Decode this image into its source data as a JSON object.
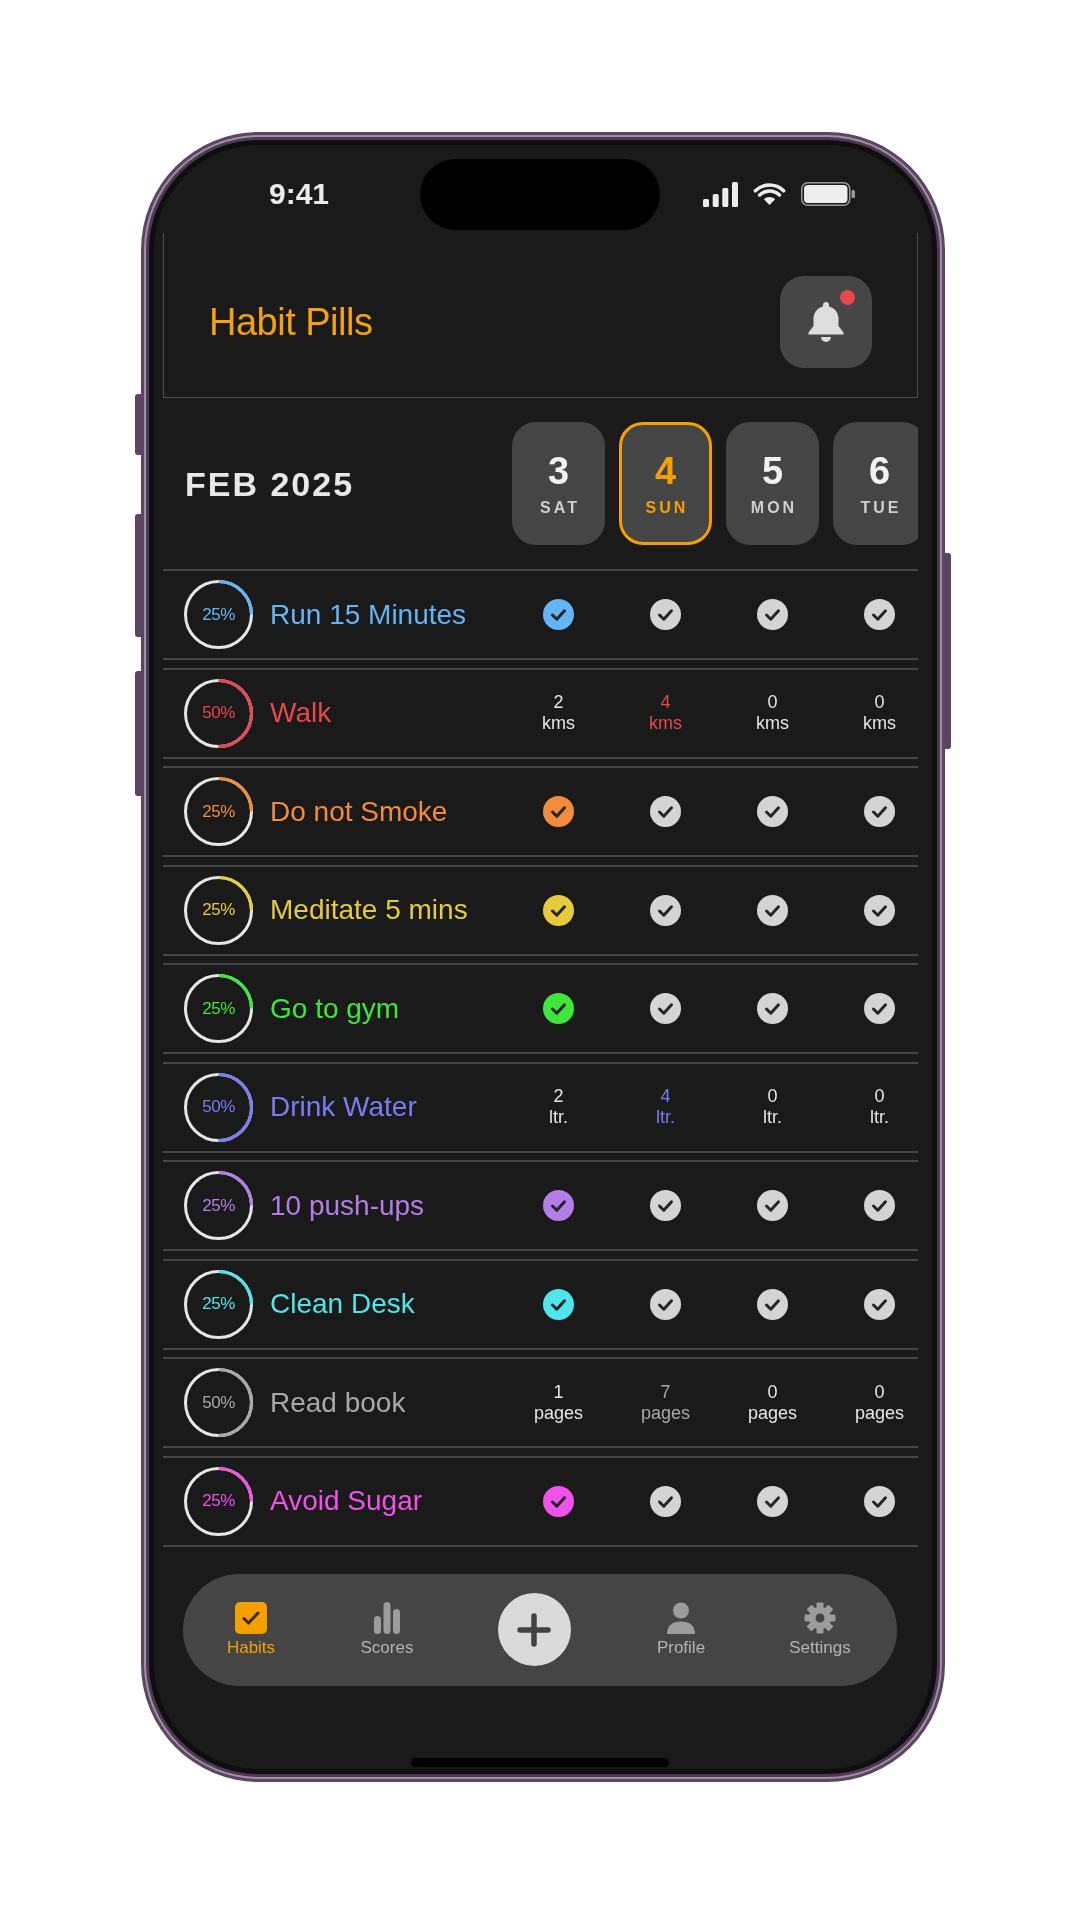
{
  "status_bar": {
    "time": "9:41"
  },
  "header": {
    "title": "Habit Pills",
    "notification_dot": true
  },
  "month": "FEB 2025",
  "dates": [
    {
      "day": "3",
      "weekday": "SAT",
      "selected": false
    },
    {
      "day": "4",
      "weekday": "SUN",
      "selected": true
    },
    {
      "day": "5",
      "weekday": "MON",
      "selected": false
    },
    {
      "day": "6",
      "weekday": "TUE",
      "selected": false
    }
  ],
  "habits": [
    {
      "name": "Run 15 Minutes",
      "color": "#64b5f6",
      "progress": {
        "label": "25%",
        "level": 0.25
      },
      "kind": "check",
      "days": [
        {
          "done": true
        },
        {
          "done": false
        },
        {
          "done": false
        },
        {
          "done": false
        }
      ]
    },
    {
      "name": "Walk",
      "color": "#e5484d",
      "progress": {
        "label": "50%",
        "level": 0.5
      },
      "kind": "amount",
      "days": [
        {
          "amount": "2 kms"
        },
        {
          "amount": "4 kms"
        },
        {
          "amount": "0 kms"
        },
        {
          "amount": "0 kms"
        }
      ]
    },
    {
      "name": "Do not Smoke",
      "color": "#f28c3a",
      "progress": {
        "label": "25%",
        "level": 0.25
      },
      "kind": "check",
      "days": [
        {
          "done": true
        },
        {
          "done": false
        },
        {
          "done": false
        },
        {
          "done": false
        }
      ]
    },
    {
      "name": "Meditate 5 mins",
      "color": "#e6cc3c",
      "progress": {
        "label": "25%",
        "level": 0.25
      },
      "kind": "check",
      "days": [
        {
          "done": true
        },
        {
          "done": false
        },
        {
          "done": false
        },
        {
          "done": false
        }
      ]
    },
    {
      "name": "Go to gym",
      "color": "#3ee83a",
      "progress": {
        "label": "25%",
        "level": 0.25
      },
      "kind": "check",
      "days": [
        {
          "done": true
        },
        {
          "done": false
        },
        {
          "done": false
        },
        {
          "done": false
        }
      ]
    },
    {
      "name": "Drink Water",
      "color": "#7c7cf2",
      "progress": {
        "label": "50%",
        "level": 0.5
      },
      "kind": "amount",
      "days": [
        {
          "amount": "2 ltr."
        },
        {
          "amount": "4 ltr."
        },
        {
          "amount": "0 ltr."
        },
        {
          "amount": "0 ltr."
        }
      ]
    },
    {
      "name": "10 push-ups",
      "color": "#b57de8",
      "progress": {
        "label": "25%",
        "level": 0.25
      },
      "kind": "check",
      "days": [
        {
          "done": true
        },
        {
          "done": false
        },
        {
          "done": false
        },
        {
          "done": false
        }
      ]
    },
    {
      "name": "Clean Desk",
      "color": "#4ee6ea",
      "progress": {
        "label": "25%",
        "level": 0.25
      },
      "kind": "check",
      "days": [
        {
          "done": true
        },
        {
          "done": false
        },
        {
          "done": false
        },
        {
          "done": false
        }
      ]
    },
    {
      "name": "Read book",
      "color": "#a8a8a8",
      "progress": {
        "label": "50%",
        "level": 0.5
      },
      "kind": "amount",
      "days": [
        {
          "amount": "1 pages"
        },
        {
          "amount": "7 pages"
        },
        {
          "amount": "0 pages"
        },
        {
          "amount": "0 pages"
        }
      ]
    },
    {
      "name": "Avoid Sugar",
      "color": "#f052ea",
      "progress": {
        "label": "25%",
        "level": 0.25
      },
      "kind": "check",
      "days": [
        {
          "done": true
        },
        {
          "done": false
        },
        {
          "done": false
        },
        {
          "done": false
        }
      ]
    }
  ],
  "nav": {
    "items": [
      {
        "kind": "tab",
        "label": "Habits",
        "selected": true
      },
      {
        "kind": "tab",
        "label": "Scores",
        "selected": false
      },
      {
        "kind": "add"
      },
      {
        "kind": "tab",
        "label": "Profile",
        "selected": false
      },
      {
        "kind": "tab",
        "label": "Settings",
        "selected": false
      }
    ]
  }
}
